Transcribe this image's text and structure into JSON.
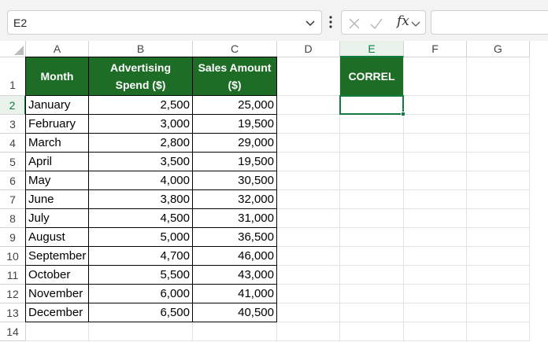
{
  "formula_bar": {
    "name_box": "E2",
    "fx_label": "fx",
    "formula": ""
  },
  "columns": [
    "A",
    "B",
    "C",
    "D",
    "E",
    "F",
    "G"
  ],
  "rows": [
    "1",
    "2",
    "3",
    "4",
    "5",
    "6",
    "7",
    "8",
    "9",
    "10",
    "11",
    "12",
    "13",
    "14"
  ],
  "table": {
    "headers": {
      "month": "Month",
      "spend": "Advertising Spend ($)",
      "sales": "Sales Amount ($)"
    },
    "rows": [
      {
        "month": "January",
        "spend": "2,500",
        "sales": "25,000"
      },
      {
        "month": "February",
        "spend": "3,000",
        "sales": "19,500"
      },
      {
        "month": "March",
        "spend": "2,800",
        "sales": "29,000"
      },
      {
        "month": "April",
        "spend": "3,500",
        "sales": "19,500"
      },
      {
        "month": "May",
        "spend": "4,000",
        "sales": "30,500"
      },
      {
        "month": "June",
        "spend": "3,800",
        "sales": "32,000"
      },
      {
        "month": "July",
        "spend": "4,500",
        "sales": "31,000"
      },
      {
        "month": "August",
        "spend": "5,000",
        "sales": "36,500"
      },
      {
        "month": "September",
        "spend": "4,700",
        "sales": "46,000"
      },
      {
        "month": "October",
        "spend": "5,500",
        "sales": "43,000"
      },
      {
        "month": "November",
        "spend": "6,000",
        "sales": "41,000"
      },
      {
        "month": "December",
        "spend": "6,500",
        "sales": "40,500"
      }
    ]
  },
  "correl_header": "CORREL",
  "colors": {
    "header_fill": "#1e6d27",
    "selection": "#107c41"
  }
}
